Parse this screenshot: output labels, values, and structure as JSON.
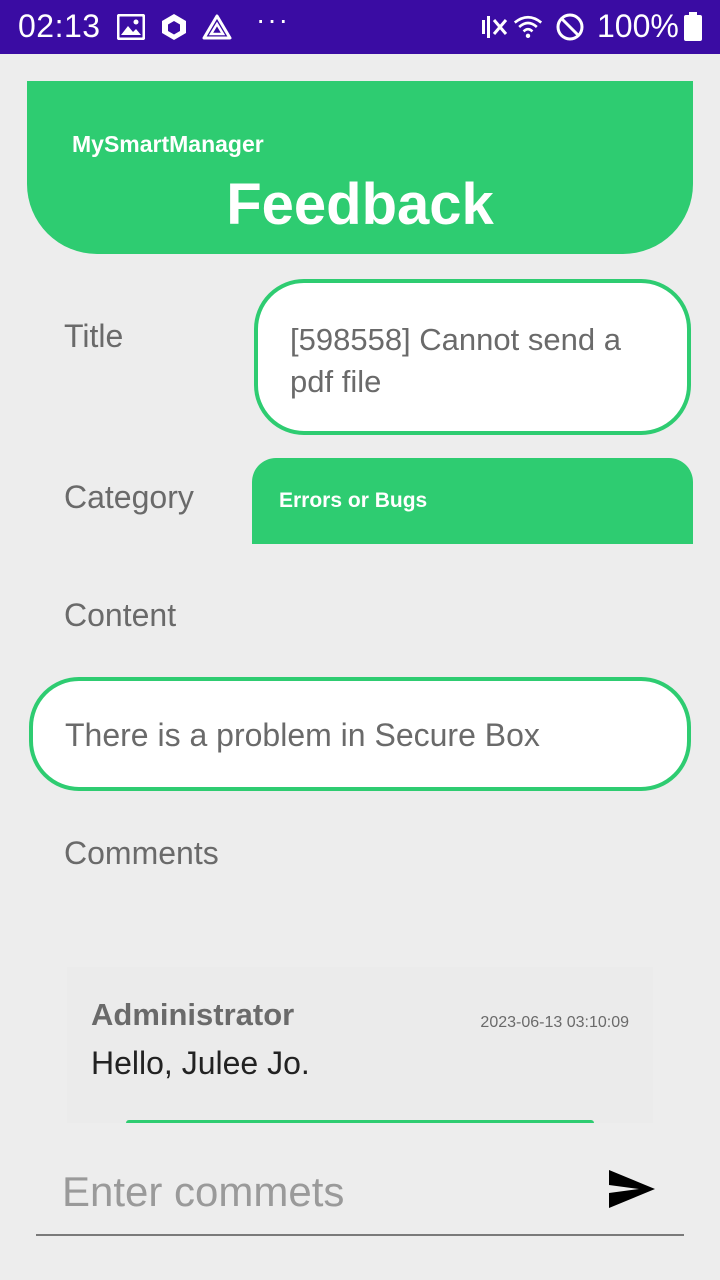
{
  "status_bar": {
    "time": "02:13",
    "dots": "···",
    "battery": "100%",
    "icons": [
      "image-icon",
      "cube-icon",
      "drive-icon",
      "mute-icon",
      "wifi-icon",
      "dnd-icon",
      "battery-icon"
    ]
  },
  "header": {
    "app_name": "MySmartManager",
    "title": "Feedback",
    "color": "#2ecc71"
  },
  "form": {
    "title_label": "Title",
    "title_value": "[598558] Cannot send a pdf file",
    "category_label": "Category",
    "category_value": "Errors or Bugs",
    "content_label": "Content",
    "content_value": "There is a problem in Secure Box",
    "comments_label": "Comments"
  },
  "comments": [
    {
      "author": "Administrator",
      "date": "2023-06-13 03:10:09",
      "text": "Hello, Julee Jo."
    }
  ],
  "input": {
    "placeholder": "Enter commets"
  }
}
